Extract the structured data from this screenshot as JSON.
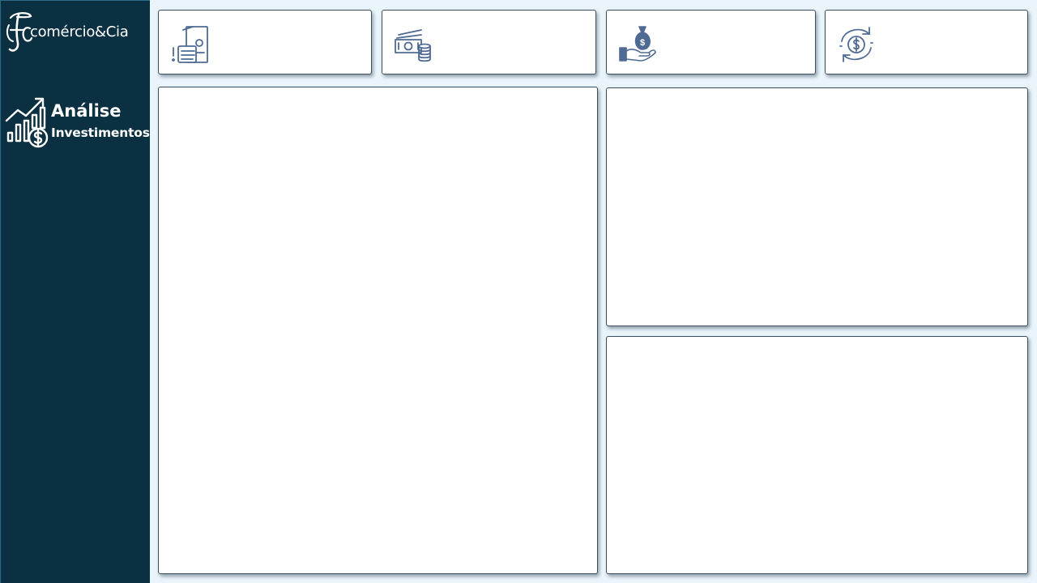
{
  "sidebar": {
    "logo": {
      "mark": "FC",
      "text": "comércio&Cia"
    },
    "section": {
      "icon": "investment-growth-icon",
      "title": "Análise",
      "subtitle": "Investimentos"
    }
  },
  "kpi_cards": [
    {
      "icon": "money-hand-alert-icon",
      "value": ""
    },
    {
      "icon": "cash-coins-icon",
      "value": ""
    },
    {
      "icon": "money-bag-hand-icon",
      "value": ""
    },
    {
      "icon": "dollar-cycle-icon",
      "value": ""
    }
  ],
  "panels": {
    "left": "",
    "top_right": "",
    "bottom_right": ""
  },
  "colors": {
    "sidebar_bg": "#0b3042",
    "page_bg": "#eaf5fb",
    "icon_color": "#4f6b93",
    "card_border": "#3d4f5c"
  }
}
